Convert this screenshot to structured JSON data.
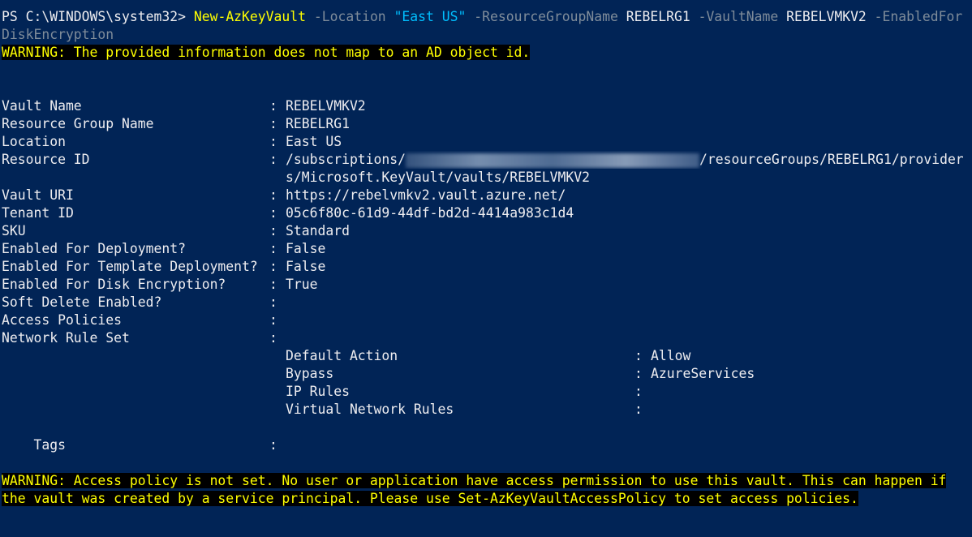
{
  "prompt": {
    "prefix": "PS C:\\WINDOWS\\system32> ",
    "cmdlet": "New-AzKeyVault",
    "p1": " -Location ",
    "v1": "\"East US\"",
    "p2": " -ResourceGroupName ",
    "v2": "REBELRG1",
    "p3": " -VaultName ",
    "v3": "REBELVMKV2",
    "p4": " -EnabledFor",
    "p4_cont": "DiskEncryption"
  },
  "warning1": "WARNING: The provided information does not map to an AD object id.",
  "props": [
    {
      "label": "Vault Name",
      "value": "REBELVMKV2"
    },
    {
      "label": "Resource Group Name",
      "value": "REBELRG1"
    },
    {
      "label": "Location",
      "value": "East US"
    },
    {
      "label": "Resource ID",
      "value": "/subscriptions/",
      "value_suffix": "/resourceGroups/REBELRG1/provider",
      "value_cont": "s/Microsoft.KeyVault/vaults/REBELVMKV2"
    },
    {
      "label": "Vault URI",
      "value": "https://rebelvmkv2.vault.azure.net/"
    },
    {
      "label": "Tenant ID",
      "value": "05c6f80c-61d9-44df-bd2d-4414a983c1d4"
    },
    {
      "label": "SKU",
      "value": "Standard"
    },
    {
      "label": "Enabled For Deployment?",
      "value": "False"
    },
    {
      "label": "Enabled For Template Deployment?",
      "value": "False"
    },
    {
      "label": "Enabled For Disk Encryption?",
      "value": "True"
    },
    {
      "label": "Soft Delete Enabled?",
      "value": ""
    },
    {
      "label": "Access Policies",
      "value": ""
    },
    {
      "label": "Network Rule Set",
      "value": ""
    }
  ],
  "network_rules": [
    {
      "label": "Default Action",
      "value": "Allow"
    },
    {
      "label": "Bypass",
      "value": "AzureServices"
    },
    {
      "label": "IP Rules",
      "value": ""
    },
    {
      "label": "Virtual Network Rules",
      "value": ""
    }
  ],
  "tags": {
    "label": "Tags",
    "value": ""
  },
  "separator": ":",
  "warning2": {
    "line1": "WARNING: Access policy is not set. No user or application have access permission to use this vault. This can happen if",
    "line2": "the vault was created by a service principal. Please use Set-AzKeyVaultAccessPolicy to set access policies."
  },
  "colors": {
    "background": "#012456",
    "text": "#eeedf0",
    "warning": "#ffff00",
    "string": "#00bfff",
    "parameter": "#7f8c9a"
  }
}
